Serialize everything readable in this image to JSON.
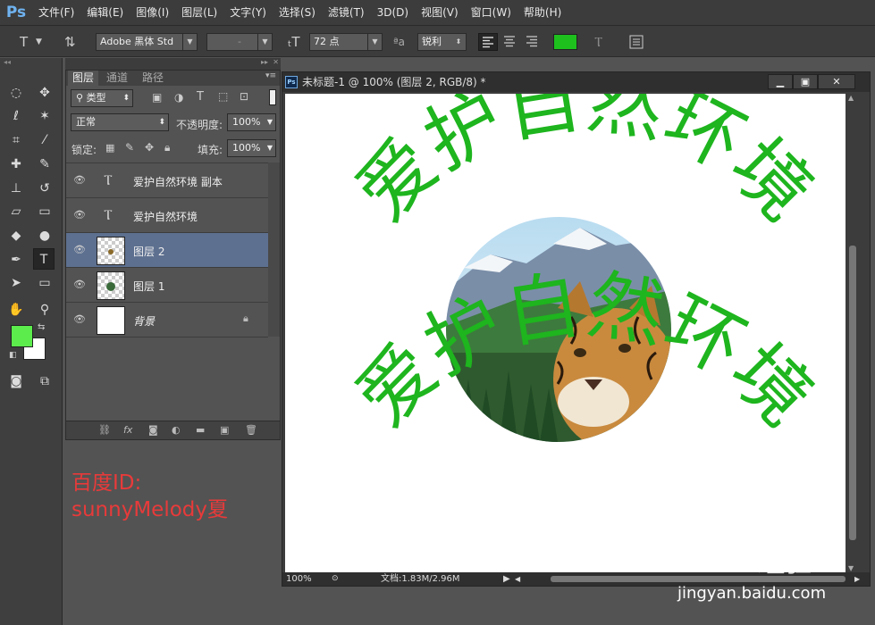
{
  "app": {
    "logo": "Ps",
    "menu": [
      "文件(F)",
      "编辑(E)",
      "图像(I)",
      "图层(L)",
      "文字(Y)",
      "选择(S)",
      "滤镜(T)",
      "3D(D)",
      "视图(V)",
      "窗口(W)",
      "帮助(H)"
    ]
  },
  "options": {
    "tool_icon": "T",
    "font_family": "Adobe 黑体 Std",
    "font_style": "-",
    "font_size": "72 点",
    "aa_label": "a",
    "antialias": "锐利",
    "text_color": "#1ec01e"
  },
  "layers_panel": {
    "tabs": [
      "图层",
      "通道",
      "路径"
    ],
    "filter_kind": "类型",
    "blend_mode": "正常",
    "opacity_label": "不透明度:",
    "opacity_value": "100%",
    "lock_label": "锁定:",
    "fill_label": "填充:",
    "fill_value": "100%",
    "layers": [
      {
        "name": "爱护自然环境 副本",
        "type": "text"
      },
      {
        "name": "爱护自然环境",
        "type": "text"
      },
      {
        "name": "图层 2",
        "type": "pixel",
        "selected": true
      },
      {
        "name": "图层 1",
        "type": "pixel"
      },
      {
        "name": "背景",
        "type": "background"
      }
    ]
  },
  "document": {
    "title": "未标题-1 @ 100% (图层 2, RGB/8) *",
    "canvas_text": "爱护自然环境",
    "zoom": "100%",
    "doc_size": "文档:1.83M/2.96M"
  },
  "colors": {
    "foreground": "#5cec4c",
    "background": "#ffffff",
    "text_green": "#1eb51e"
  },
  "watermark": {
    "line1": "百度ID:",
    "line2": "sunnyMelody夏"
  },
  "baidu": {
    "logo": "Baidu经验",
    "url": "jingyan.baidu.com"
  }
}
